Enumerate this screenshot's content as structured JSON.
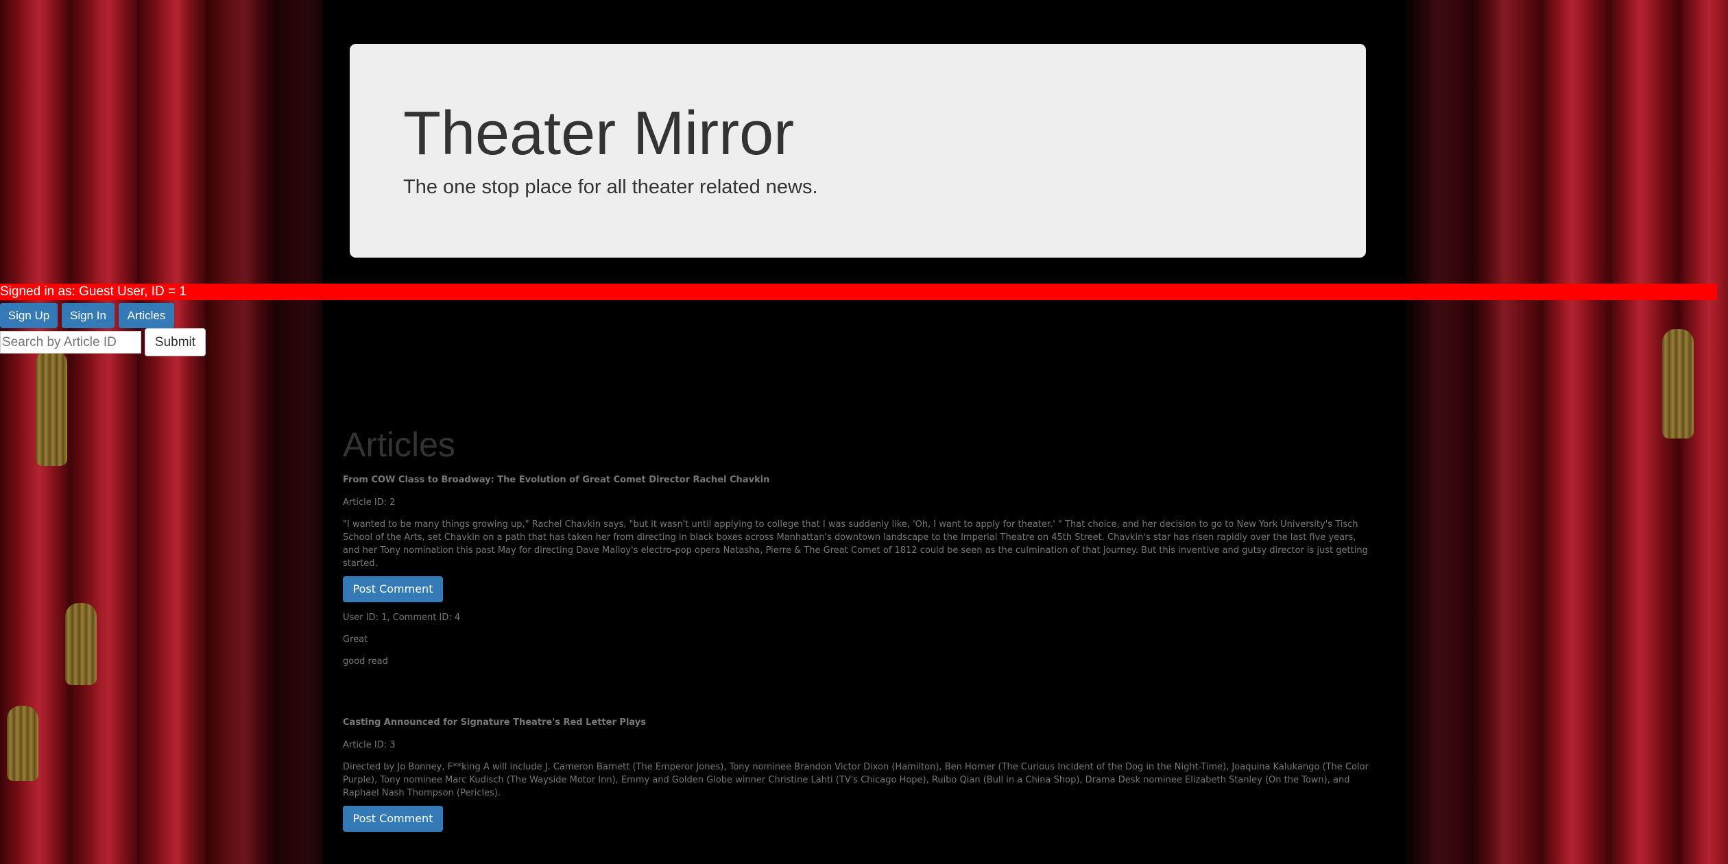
{
  "header": {
    "title": "Theater Mirror",
    "subtitle": "The one stop place for all theater related news."
  },
  "status_bar": {
    "text": "Signed in as: Guest User, ID = 1",
    "color": "#ff0000"
  },
  "nav": {
    "sign_up": "Sign Up",
    "sign_in": "Sign In",
    "articles": "Articles"
  },
  "search": {
    "placeholder": "Search by Article ID",
    "value": "",
    "submit_label": "Submit"
  },
  "articles_section": {
    "heading": "Articles",
    "items": [
      {
        "title": "From COW Class to Broadway: The Evolution of Great Comet Director Rachel Chavkin",
        "article_id_text": "Article ID: 2",
        "body": "\"I wanted to be many things growing up,\" Rachel Chavkin says, \"but it wasn't until applying to college that I was suddenly like, 'Oh, I want to apply for theater.' \" That choice, and her decision to go to New York University's Tisch School of the Arts, set Chavkin on a path that has taken her from directing in black boxes across Manhattan's downtown landscape to the Imperial Theatre on 45th Street. Chavkin's star has risen rapidly over the last five years, and her Tony nomination this past May for directing Dave Malloy's electro-pop opera Natasha, Pierre & The Great Comet of 1812 could be seen as the culmination of that journey. But this inventive and gutsy director is just getting started.",
        "post_comment_label": "Post Comment",
        "comments": [
          {
            "meta": "User ID: 1, Comment ID: 4",
            "title": "Great",
            "text": "good read"
          }
        ]
      },
      {
        "title": "Casting Announced for Signature Theatre's Red Letter Plays",
        "article_id_text": "Article ID: 3",
        "body": "Directed by Jo Bonney, F**king A will include J. Cameron Barnett (The Emperor Jones), Tony nominee Brandon Victor Dixon (Hamilton), Ben Horner (The Curious Incident of the Dog in the Night-Time), Joaquina Kalukango (The Color Purple), Tony nominee Marc Kudisch (The Wayside Motor Inn), Emmy and Golden Globe winner Christine Lahti (TV's Chicago Hope), Ruibo Qian (Bull in a China Shop), Drama Desk nominee Elizabeth Stanley (On the Town), and Raphael Nash Thompson (Pericles).",
        "post_comment_label": "Post Comment",
        "comments": []
      }
    ]
  },
  "colors": {
    "primary_button": "#337ab7",
    "jumbotron_bg": "#eeeeee",
    "page_bg": "#000000"
  }
}
